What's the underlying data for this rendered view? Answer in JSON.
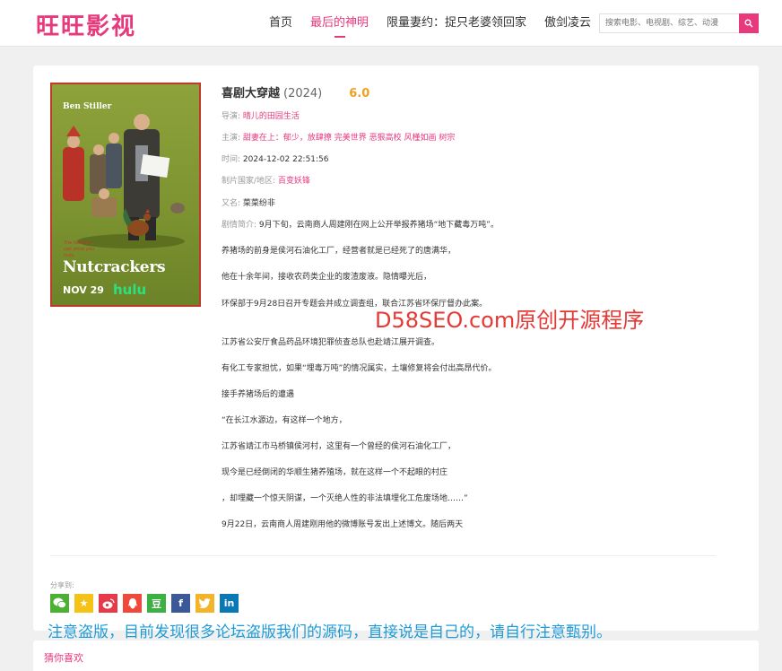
{
  "site": {
    "logo": "旺旺影视"
  },
  "nav": [
    {
      "label": "首页",
      "active": false
    },
    {
      "label": "最后的神明",
      "active": true
    },
    {
      "label": "限量妻约：捉只老婆领回家",
      "active": false
    },
    {
      "label": "傲剑凌云",
      "active": false
    }
  ],
  "search": {
    "placeholder": "搜索电影、电视剧、综艺、动漫"
  },
  "poster": {
    "actor": "Ben Stiller",
    "tagline": "The holidays can drive you nuts.",
    "title": "Nutcrackers",
    "date": "NOV 29",
    "brand": "hulu"
  },
  "movie": {
    "title": "喜剧大穿越",
    "year": "(2024)",
    "score": "6.0",
    "director_label": "导演:",
    "director": "晴儿的田园生活",
    "cast_label": "主演:",
    "cast": "甜妻在上：郁少，放肆撩 完美世界 恶狠高校 风槿如画 树宗",
    "time_label": "时间:",
    "time": "2024-12-02 22:51:56",
    "region_label": "制片国家/地区:",
    "region": "百变妖锋",
    "alias_label": "又名:",
    "alias": "菜菜纷非",
    "intro_label": "剧情简介:",
    "intro_first": "9月下旬，云南商人周建刚在网上公开举报养猪场“地下藏毒万吨”。",
    "paragraphs": [
      "养猪场的前身是侯河石油化工厂，经营者就是已经死了的唐满华，",
      "他在十余年间，接收农药类企业的废渣废液。隐情曝光后，",
      "环保部于9月28日召开专题会并成立调查组，联合江苏省环保厅督办此案。",
      "江苏省公安厅食品药品环境犯罪侦查总队也赴靖江展开调查。",
      "有化工专家担忧，如果“埋毒万吨”的情况属实，土壤修复将会付出高昂代价。",
      "接手养猪场后的遭遇",
      "“在长江水源边，有这样一个地方，",
      "江苏省靖江市马桥镇侯河村，这里有一个曾经的侯河石油化工厂，",
      "现今是已经倒闭的华顺生猪养殖场，就在这样一个不起眼的村庄",
      "，却埋藏一个惊天阴谋，一个灭绝人性的非法填埋化工危废场地……”",
      "9月22日，云南商人周建刚用他的微博账号发出上述博文。随后两天"
    ]
  },
  "watermark": "D58SEO.com原创开源程序",
  "share": {
    "label": "分享到:",
    "items": [
      {
        "name": "wechat",
        "glyph": "",
        "color": "#4cb033"
      },
      {
        "name": "qzone",
        "glyph": "★",
        "color": "#f5c218"
      },
      {
        "name": "weibo",
        "glyph": "",
        "color": "#e6394a"
      },
      {
        "name": "qq",
        "glyph": "",
        "color": "#f0483a"
      },
      {
        "name": "douban",
        "glyph": "豆",
        "color": "#3cb043"
      },
      {
        "name": "facebook",
        "glyph": "f",
        "color": "#3b5998"
      },
      {
        "name": "twitter",
        "glyph": "",
        "color": "#f2b42b"
      },
      {
        "name": "linkedin",
        "glyph": "in",
        "color": "#0a78b5"
      }
    ]
  },
  "notice": "注意盗版，目前发现很多论坛盗版我们的源码，直接说是自己的，请自行注意甄别。",
  "guess": {
    "title": "猜你喜欢"
  },
  "colors": {
    "accent": "#e8397d",
    "score": "#f0a020",
    "watermark": "#e53935",
    "notice": "#1e9bd7"
  }
}
